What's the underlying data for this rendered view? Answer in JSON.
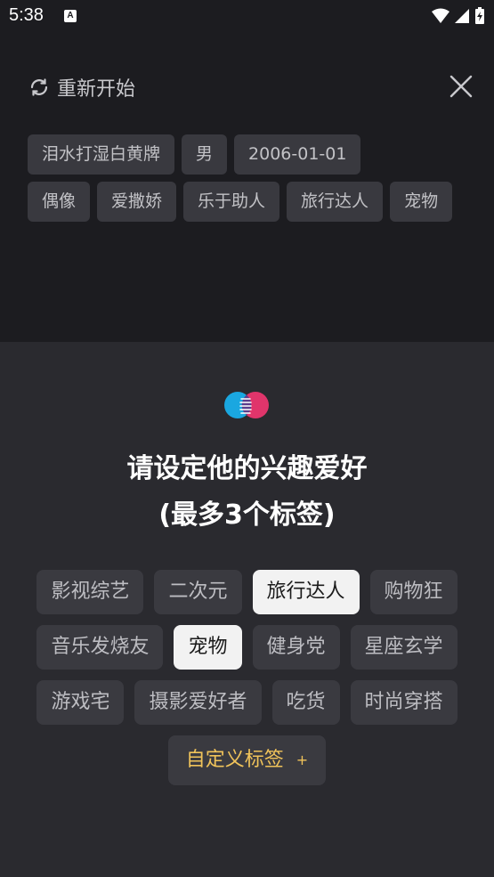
{
  "status": {
    "time": "5:38",
    "notif_letter": "A"
  },
  "header": {
    "restart_label": "重新开始"
  },
  "profile_tags": {
    "row1": [
      "泪水打湿白黄牌",
      "男",
      "2006-01-01"
    ],
    "row2": [
      "偶像",
      "爱撒娇",
      "乐于助人",
      "旅行达人",
      "宠物"
    ]
  },
  "sheet": {
    "title_line1": "请设定他的兴趣爱好",
    "title_line2": "(最多3个标签)",
    "tag_rows": [
      [
        {
          "label": "影视综艺",
          "selected": false
        },
        {
          "label": "二次元",
          "selected": false
        },
        {
          "label": "旅行达人",
          "selected": true
        },
        {
          "label": "购物狂",
          "selected": false
        }
      ],
      [
        {
          "label": "音乐发烧友",
          "selected": false
        },
        {
          "label": "宠物",
          "selected": true
        },
        {
          "label": "健身党",
          "selected": false
        },
        {
          "label": "星座玄学",
          "selected": false
        }
      ],
      [
        {
          "label": "游戏宅",
          "selected": false
        },
        {
          "label": "摄影爱好者",
          "selected": false
        },
        {
          "label": "吃货",
          "selected": false
        },
        {
          "label": "时尚穿搭",
          "selected": false
        }
      ]
    ],
    "custom_label": "自定义标签",
    "custom_plus": "+"
  },
  "colors": {
    "accent_yellow": "#f0c35a",
    "logo_blue": "#1aa7e0",
    "logo_pink": "#e0356b"
  }
}
